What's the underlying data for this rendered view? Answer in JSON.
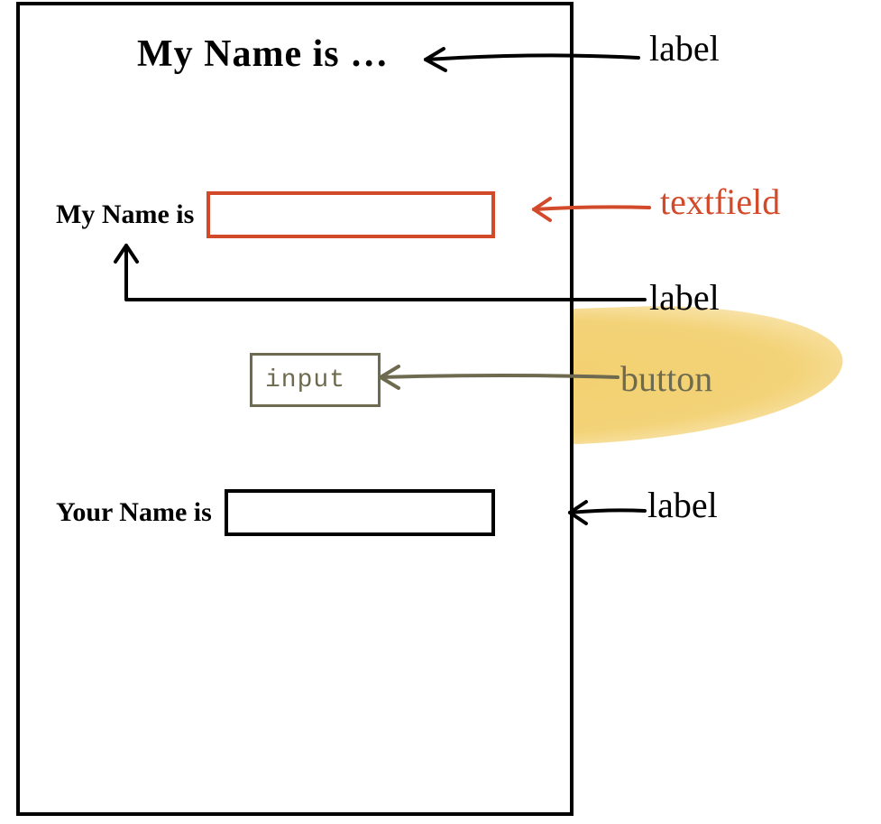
{
  "heading": {
    "text": "My Name is …"
  },
  "form": {
    "my_name_label": "My Name is",
    "my_name_value": "",
    "input_button_label": "input",
    "your_name_label": "Your Name is",
    "your_name_value": ""
  },
  "annotations": {
    "top": "label",
    "textfield": "textfield",
    "mid": "label",
    "button": "button",
    "bottom": "label"
  }
}
